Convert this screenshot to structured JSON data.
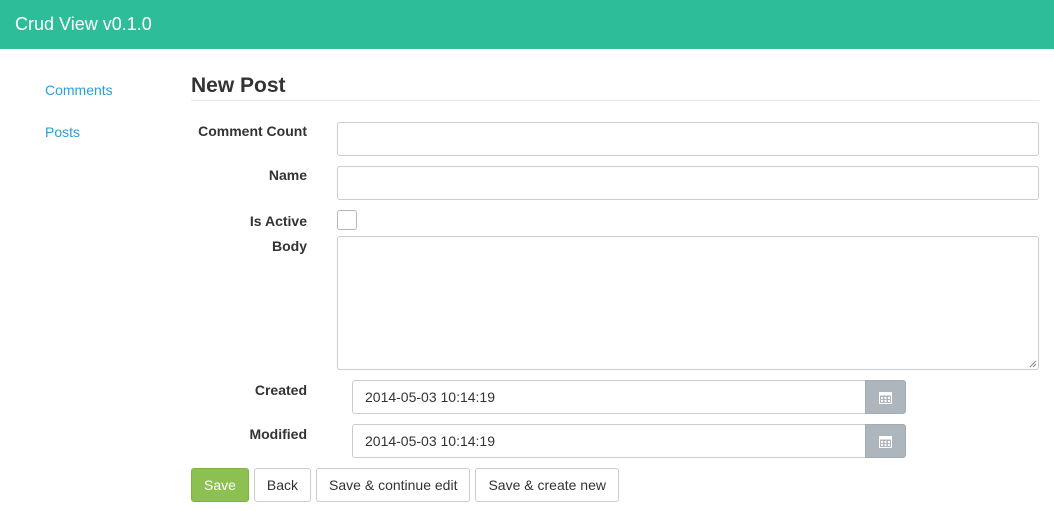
{
  "app": {
    "brand": "Crud View v0.1.0"
  },
  "sidebar": {
    "items": [
      {
        "label": "Comments"
      },
      {
        "label": "Posts"
      }
    ]
  },
  "page": {
    "title": "New Post"
  },
  "form": {
    "comment_count": {
      "label": "Comment Count",
      "value": ""
    },
    "name": {
      "label": "Name",
      "value": ""
    },
    "is_active": {
      "label": "Is Active",
      "checked": false
    },
    "body": {
      "label": "Body",
      "value": ""
    },
    "created": {
      "label": "Created",
      "value": "2014-05-03 10:14:19"
    },
    "modified": {
      "label": "Modified",
      "value": "2014-05-03 10:14:19"
    }
  },
  "actions": {
    "save": "Save",
    "back": "Back",
    "save_continue": "Save & continue edit",
    "save_new": "Save & create new"
  },
  "colors": {
    "navbar": "#2ebd99",
    "link": "#2a9fd6",
    "save_button": "#8cc152",
    "calendar_addon": "#adb5bd"
  },
  "icons": {
    "calendar": "calendar-icon",
    "resize": "resize-grip-icon"
  }
}
